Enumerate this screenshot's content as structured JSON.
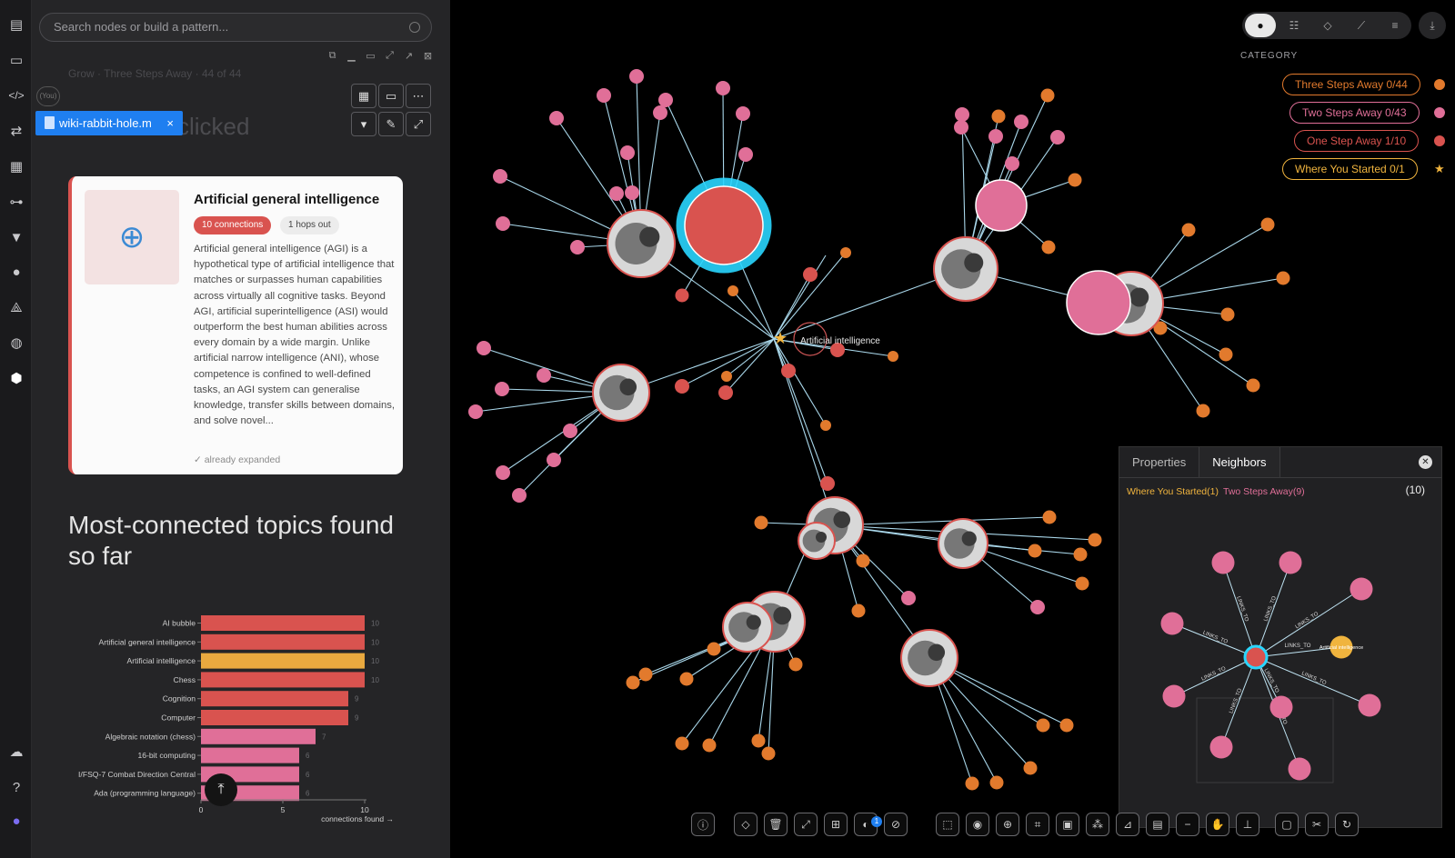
{
  "search": {
    "placeholder": "Search nodes or build a pattern..."
  },
  "left": {
    "ghost_text": "Grow · Three Steps Away · 44 of 44",
    "you_badge": "(You)",
    "file_tab": "wiki-rabbit-hole.m",
    "file_tab_close": "×",
    "heading_faded": "clicked",
    "card": {
      "title": "Artificial general intelligence",
      "badge_connections": "10 connections",
      "badge_hops": "1 hops out",
      "description": "Artificial general intelligence (AGI) is a hypothetical type of artificial intelligence that matches or surpasses human capabilities across virtually all cognitive tasks. Beyond AGI, artificial superintelligence (ASI) would outperform the best human abilities across every domain by a wide margin. Unlike artificial narrow intelligence (ANI), whose competence is confined to well-defined tasks, an AGI system can generalise knowledge, transfer skills between domains, and solve novel...",
      "status": "✓ already expanded"
    },
    "section_title": "Most-connected topics found so far"
  },
  "chart_data": {
    "type": "bar",
    "orientation": "horizontal",
    "categories": [
      "AI bubble",
      "Artificial general intelligence",
      "Artificial intelligence",
      "Chess",
      "Cognition",
      "Computer",
      "Algebraic notation (chess)",
      "16-bit computing",
      "I/FSQ-7 Combat Direction Central",
      "Ada (programming language)"
    ],
    "values": [
      10,
      10,
      10,
      10,
      9,
      9,
      7,
      6,
      6,
      6
    ],
    "colors": [
      "#d9534f",
      "#d9534f",
      "#e9a93f",
      "#d9534f",
      "#d9534f",
      "#d9534f",
      "#e06f98",
      "#e06f98",
      "#e06f98",
      "#e06f98"
    ],
    "xlabel": "connections found →",
    "xticks": [
      "0",
      "5",
      "10"
    ],
    "xlim": [
      0,
      10
    ],
    "grid": false
  },
  "graph": {
    "center_label": "Artificial intelligence",
    "category_title": "CATEGORY",
    "categories": [
      {
        "label": "Three Steps Away 0/44",
        "color": "#e27a2d"
      },
      {
        "label": "Two Steps Away 0/43",
        "color": "#e06f98"
      },
      {
        "label": "One Step Away 1/10",
        "color": "#d9534f"
      },
      {
        "label": "Where You Started 0/1",
        "color": "#f0b43e"
      }
    ]
  },
  "neighbors": {
    "tab_properties": "Properties",
    "tab_neighbors": "Neighbors",
    "legend_started": "Where You Started(1)",
    "legend_two": "Two Steps Away(9)",
    "count": "(10)",
    "edge_label": "LINKS_TO",
    "started_label": "Artificial intelligence"
  },
  "toolbar_badge": "1"
}
